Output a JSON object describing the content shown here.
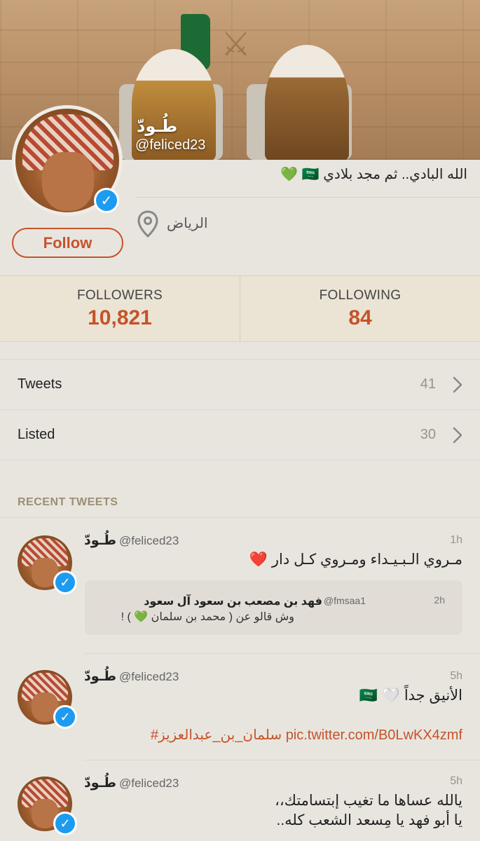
{
  "profile": {
    "name": "طُـودّ",
    "handle": "@feliced23",
    "bio": "الله البادي.. ثم مجد بلادي 🇸🇦 💚",
    "location": "الرياض",
    "follow_label": "Follow"
  },
  "stats": {
    "followers_label": "FOLLOWERS",
    "followers_value": "10,821",
    "following_label": "FOLLOWING",
    "following_value": "84"
  },
  "rows": [
    {
      "label": "Tweets",
      "count": "41"
    },
    {
      "label": "Listed",
      "count": "30"
    }
  ],
  "recent_header": "RECENT TWEETS",
  "tweets": [
    {
      "name": "طُـودّ",
      "handle": "@feliced23",
      "time": "1h",
      "text": "مـروي الـبـيـداء ومـروي كـل دار ❤️",
      "quote": {
        "name": "فهد بن مصعب بن سعود آل سعود",
        "handle": "@fmsaa1",
        "time": "2h",
        "text": "وش قالو عن ( محمد بن سلمان 💚 ) !"
      }
    },
    {
      "name": "طُـودّ",
      "handle": "@feliced23",
      "time": "5h",
      "text": "الأنيق جداً 🤍 🇸🇦",
      "hashtag": "#سلمان_بن_عبدالعزيز",
      "link": "pic.twitter.com/B0LwKX4zmf"
    },
    {
      "name": "طُـودّ",
      "handle": "@feliced23",
      "time": "5h",
      "text_line1": "يالله عساها ما تغيب إبتسامتك،،",
      "text_line2": "يا أبو فهد يا مِسعد الشعب كله.."
    }
  ],
  "colors": {
    "accent": "#c5532a",
    "verified": "#1d9bf0",
    "background": "#e8e5df",
    "stats_background": "#ebe4d5"
  }
}
